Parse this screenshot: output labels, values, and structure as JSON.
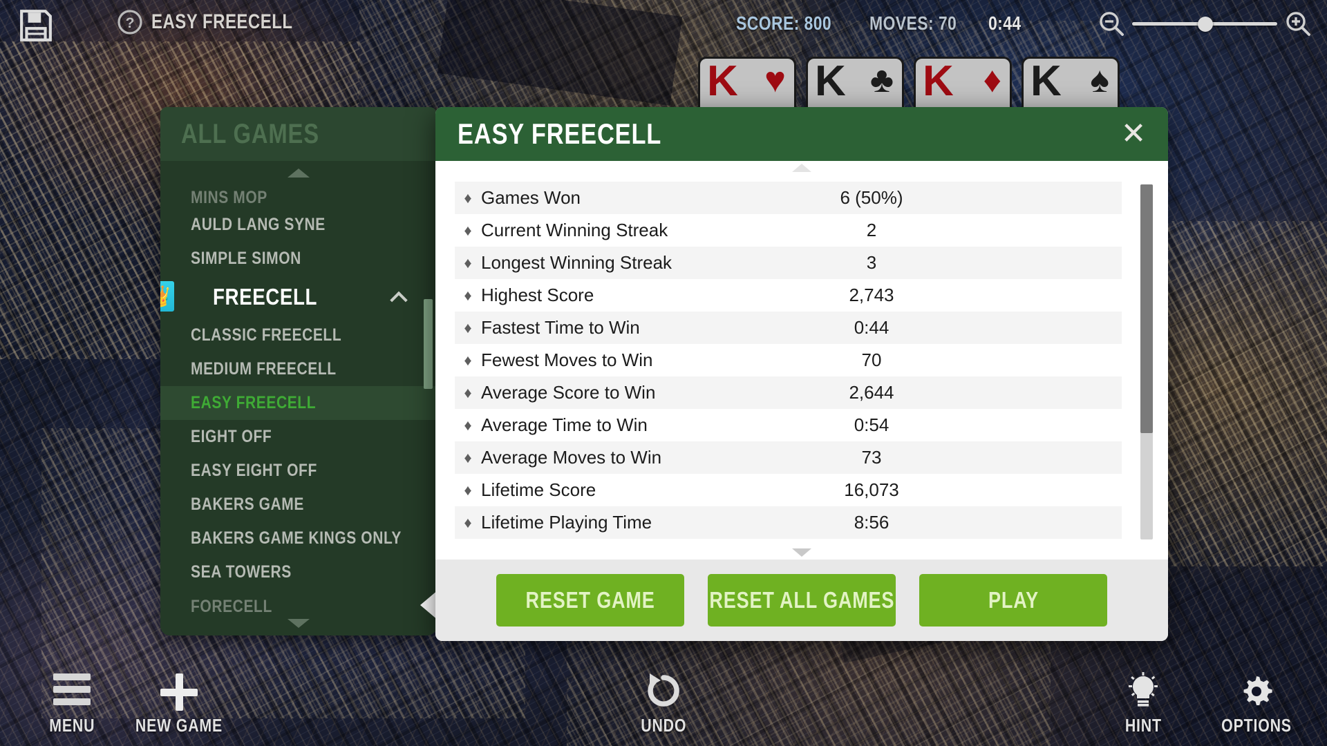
{
  "topbar": {
    "save_icon": "save-icon",
    "help_icon": "help-icon",
    "title": "EASY FREECELL",
    "score": "SCORE: 800",
    "moves": "MOVES: 70",
    "timer": "0:44",
    "zoom_out_icon": "zoom-out-icon",
    "zoom_in_icon": "zoom-in-icon",
    "zoom_slider_value": "50"
  },
  "foundations": [
    {
      "rank": "K",
      "suit": "♥",
      "suit_name": "hearts",
      "color": "#9e0b12"
    },
    {
      "rank": "K",
      "suit": "♣",
      "suit_name": "clubs",
      "color": "#1c1c1c"
    },
    {
      "rank": "K",
      "suit": "♦",
      "suit_name": "diamonds",
      "color": "#9e0b12"
    },
    {
      "rank": "K",
      "suit": "♠",
      "suit_name": "spades",
      "color": "#1c1c1c"
    }
  ],
  "sidebar": {
    "header": "ALL GAMES",
    "scroll_up_icon": "chevron-up-icon",
    "scroll_down_icon": "chevron-down-icon",
    "items": [
      {
        "label": "MINS MOP",
        "state": "clipped"
      },
      {
        "label": "AULD LANG SYNE",
        "state": "normal"
      },
      {
        "label": "SIMPLE SIMON",
        "state": "normal"
      },
      {
        "label": "FREECELL",
        "state": "parent",
        "badge": "👑"
      },
      {
        "label": "CLASSIC FREECELL",
        "state": "child"
      },
      {
        "label": "MEDIUM FREECELL",
        "state": "child"
      },
      {
        "label": "EASY FREECELL",
        "state": "selected"
      },
      {
        "label": "EIGHT OFF",
        "state": "normal"
      },
      {
        "label": "EASY EIGHT OFF",
        "state": "normal"
      },
      {
        "label": "BAKERS GAME",
        "state": "normal"
      },
      {
        "label": "BAKERS GAME KINGS ONLY",
        "state": "normal"
      },
      {
        "label": "SEA TOWERS",
        "state": "normal"
      },
      {
        "label": "FORECELL",
        "state": "clipped"
      }
    ]
  },
  "dialog": {
    "title": "EASY FREECELL",
    "close_icon": "close-icon",
    "scroll_up_icon": "triangle-up-icon",
    "scroll_down_icon": "triangle-down-icon",
    "stats": [
      {
        "bullet": "♦",
        "name": "Games Won",
        "value": "6 (50%)"
      },
      {
        "bullet": "♦",
        "name": "Current Winning Streak",
        "value": "2"
      },
      {
        "bullet": "♦",
        "name": "Longest Winning Streak",
        "value": "3"
      },
      {
        "bullet": "♦",
        "name": "Highest Score",
        "value": "2,743"
      },
      {
        "bullet": "♦",
        "name": "Fastest Time to Win",
        "value": "0:44"
      },
      {
        "bullet": "♦",
        "name": "Fewest Moves to Win",
        "value": "70"
      },
      {
        "bullet": "♦",
        "name": "Average Score to Win",
        "value": "2,644"
      },
      {
        "bullet": "♦",
        "name": "Average Time to Win",
        "value": "0:54"
      },
      {
        "bullet": "♦",
        "name": "Average Moves to Win",
        "value": "73"
      },
      {
        "bullet": "♦",
        "name": "Lifetime Score",
        "value": "16,073"
      },
      {
        "bullet": "♦",
        "name": "Lifetime Playing Time",
        "value": "8:56"
      }
    ],
    "buttons": {
      "reset_game": "RESET GAME",
      "reset_all_games": "RESET ALL GAMES",
      "play": "PLAY"
    }
  },
  "bottombar": {
    "menu": {
      "label": "MENU",
      "icon": "hamburger-icon"
    },
    "new_game": {
      "label": "NEW GAME",
      "icon": "plus-icon"
    },
    "undo": {
      "label": "UNDO",
      "icon": "undo-arrow-icon"
    },
    "hint": {
      "label": "HINT",
      "icon": "lightbulb-icon"
    },
    "options": {
      "label": "OPTIONS",
      "icon": "gear-icon"
    }
  },
  "colors": {
    "dialog_header_green": "#2c6135",
    "button_green": "#6fb122",
    "selected_green": "#3fab35",
    "sidebar_green": "#243a27"
  }
}
